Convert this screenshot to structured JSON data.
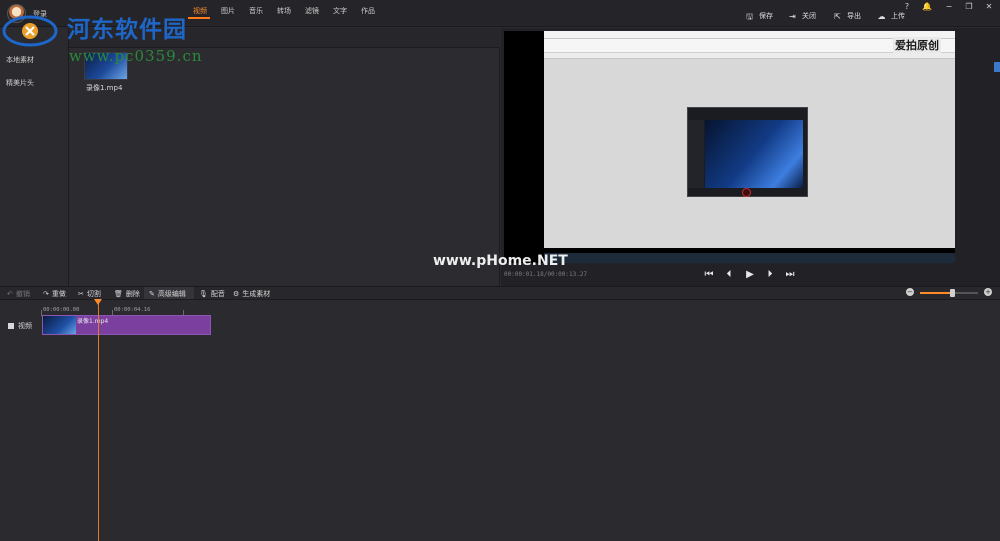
{
  "header": {
    "username": "登录",
    "buttons": [
      {
        "label": "保存",
        "icon": "save-icon"
      },
      {
        "label": "关闭",
        "icon": "close-project-icon"
      },
      {
        "label": "导出",
        "icon": "export-icon"
      },
      {
        "label": "上传",
        "icon": "upload-icon"
      }
    ],
    "window_controls": [
      "?",
      "🔔",
      "−",
      "❐",
      "✕"
    ]
  },
  "watermark": {
    "title": "河东软件园",
    "url": "www.pc0359.cn"
  },
  "left_nav": {
    "items": [
      "本地素材",
      "精美片头"
    ]
  },
  "media_tabs": {
    "tabs": [
      "视频",
      "图片",
      "音乐",
      "转场",
      "滤镜",
      "文字",
      "作品"
    ],
    "active": "视频"
  },
  "media": {
    "items": [
      {
        "label": "录像1.mp4"
      }
    ]
  },
  "preview": {
    "timecode": "00:00:01.18/00:00:13.27",
    "watermark": "www.pHome.NET",
    "inner_brand": "爱拍原创",
    "controls": [
      "skip-to-start",
      "prev-frame",
      "play",
      "next-frame",
      "skip-to-end"
    ]
  },
  "edit_toolbar": {
    "tools": [
      {
        "label": "撤销",
        "icon": "undo-icon",
        "enabled": false
      },
      {
        "label": "重做",
        "icon": "redo-icon",
        "enabled": true
      },
      {
        "label": "切割",
        "icon": "scissors-icon",
        "enabled": true
      },
      {
        "label": "删除",
        "icon": "trash-icon",
        "enabled": true
      },
      {
        "label": "高级编辑",
        "icon": "pencil-icon",
        "enabled": true
      },
      {
        "label": "配音",
        "icon": "microphone-icon",
        "enabled": true
      },
      {
        "label": "生成素材",
        "icon": "generate-icon",
        "enabled": true
      }
    ],
    "zoom_level": 0.55
  },
  "timeline": {
    "track_label": "视频",
    "ruler": [
      "00:00:00.00",
      "00:00:04.16"
    ],
    "clip_name": "录像1.mp4"
  },
  "colors": {
    "accent": "#ff8a2a",
    "clip": "#7b3fa0",
    "background": "#2a2a2f"
  }
}
